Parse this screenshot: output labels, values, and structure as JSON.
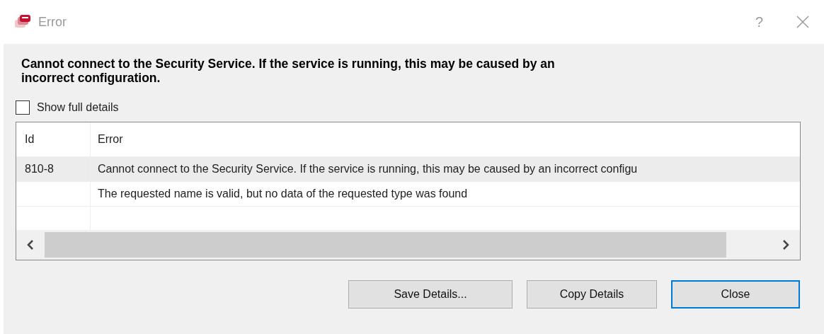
{
  "window": {
    "title": "Error"
  },
  "title_bar_buttons": [
    {
      "kind": "help",
      "label": "?"
    },
    {
      "kind": "close"
    }
  ],
  "message": "Cannot connect to the Security Service. If the service is running, this may be caused by an incorrect configuration.",
  "show_full_details": {
    "label": "Show full details",
    "checked": false
  },
  "table": {
    "columns": [
      "Id",
      "Error"
    ],
    "rows": [
      {
        "id": "810-8",
        "error": "Cannot connect to the Security Service. If the service is running, this may be caused by an incorrect configu",
        "selected": true
      },
      {
        "id": "",
        "error": "The requested name is valid, but no data of the requested type was found",
        "selected": false
      }
    ]
  },
  "buttons": [
    {
      "label": "Save Details...",
      "default": false
    },
    {
      "label": "Copy Details",
      "default": false
    },
    {
      "label": "Close",
      "default": true
    }
  ]
}
